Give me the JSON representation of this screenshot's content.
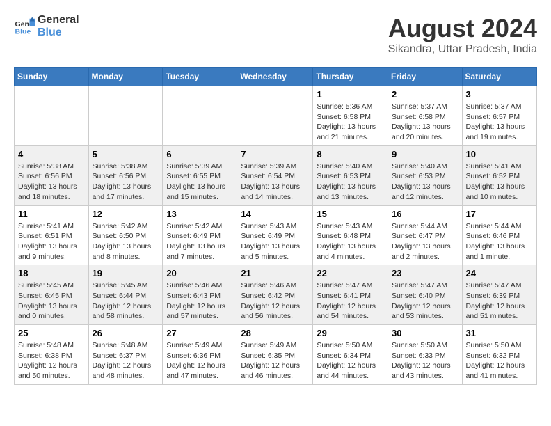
{
  "header": {
    "logo_line1": "General",
    "logo_line2": "Blue",
    "main_title": "August 2024",
    "subtitle": "Sikandra, Uttar Pradesh, India"
  },
  "days_of_week": [
    "Sunday",
    "Monday",
    "Tuesday",
    "Wednesday",
    "Thursday",
    "Friday",
    "Saturday"
  ],
  "weeks": [
    [
      {
        "day": "",
        "content": ""
      },
      {
        "day": "",
        "content": ""
      },
      {
        "day": "",
        "content": ""
      },
      {
        "day": "",
        "content": ""
      },
      {
        "day": "1",
        "content": "Sunrise: 5:36 AM\nSunset: 6:58 PM\nDaylight: 13 hours and 21 minutes."
      },
      {
        "day": "2",
        "content": "Sunrise: 5:37 AM\nSunset: 6:58 PM\nDaylight: 13 hours and 20 minutes."
      },
      {
        "day": "3",
        "content": "Sunrise: 5:37 AM\nSunset: 6:57 PM\nDaylight: 13 hours and 19 minutes."
      }
    ],
    [
      {
        "day": "4",
        "content": "Sunrise: 5:38 AM\nSunset: 6:56 PM\nDaylight: 13 hours and 18 minutes."
      },
      {
        "day": "5",
        "content": "Sunrise: 5:38 AM\nSunset: 6:56 PM\nDaylight: 13 hours and 17 minutes."
      },
      {
        "day": "6",
        "content": "Sunrise: 5:39 AM\nSunset: 6:55 PM\nDaylight: 13 hours and 15 minutes."
      },
      {
        "day": "7",
        "content": "Sunrise: 5:39 AM\nSunset: 6:54 PM\nDaylight: 13 hours and 14 minutes."
      },
      {
        "day": "8",
        "content": "Sunrise: 5:40 AM\nSunset: 6:53 PM\nDaylight: 13 hours and 13 minutes."
      },
      {
        "day": "9",
        "content": "Sunrise: 5:40 AM\nSunset: 6:53 PM\nDaylight: 13 hours and 12 minutes."
      },
      {
        "day": "10",
        "content": "Sunrise: 5:41 AM\nSunset: 6:52 PM\nDaylight: 13 hours and 10 minutes."
      }
    ],
    [
      {
        "day": "11",
        "content": "Sunrise: 5:41 AM\nSunset: 6:51 PM\nDaylight: 13 hours and 9 minutes."
      },
      {
        "day": "12",
        "content": "Sunrise: 5:42 AM\nSunset: 6:50 PM\nDaylight: 13 hours and 8 minutes."
      },
      {
        "day": "13",
        "content": "Sunrise: 5:42 AM\nSunset: 6:49 PM\nDaylight: 13 hours and 7 minutes."
      },
      {
        "day": "14",
        "content": "Sunrise: 5:43 AM\nSunset: 6:49 PM\nDaylight: 13 hours and 5 minutes."
      },
      {
        "day": "15",
        "content": "Sunrise: 5:43 AM\nSunset: 6:48 PM\nDaylight: 13 hours and 4 minutes."
      },
      {
        "day": "16",
        "content": "Sunrise: 5:44 AM\nSunset: 6:47 PM\nDaylight: 13 hours and 2 minutes."
      },
      {
        "day": "17",
        "content": "Sunrise: 5:44 AM\nSunset: 6:46 PM\nDaylight: 13 hours and 1 minute."
      }
    ],
    [
      {
        "day": "18",
        "content": "Sunrise: 5:45 AM\nSunset: 6:45 PM\nDaylight: 13 hours and 0 minutes."
      },
      {
        "day": "19",
        "content": "Sunrise: 5:45 AM\nSunset: 6:44 PM\nDaylight: 12 hours and 58 minutes."
      },
      {
        "day": "20",
        "content": "Sunrise: 5:46 AM\nSunset: 6:43 PM\nDaylight: 12 hours and 57 minutes."
      },
      {
        "day": "21",
        "content": "Sunrise: 5:46 AM\nSunset: 6:42 PM\nDaylight: 12 hours and 56 minutes."
      },
      {
        "day": "22",
        "content": "Sunrise: 5:47 AM\nSunset: 6:41 PM\nDaylight: 12 hours and 54 minutes."
      },
      {
        "day": "23",
        "content": "Sunrise: 5:47 AM\nSunset: 6:40 PM\nDaylight: 12 hours and 53 minutes."
      },
      {
        "day": "24",
        "content": "Sunrise: 5:47 AM\nSunset: 6:39 PM\nDaylight: 12 hours and 51 minutes."
      }
    ],
    [
      {
        "day": "25",
        "content": "Sunrise: 5:48 AM\nSunset: 6:38 PM\nDaylight: 12 hours and 50 minutes."
      },
      {
        "day": "26",
        "content": "Sunrise: 5:48 AM\nSunset: 6:37 PM\nDaylight: 12 hours and 48 minutes."
      },
      {
        "day": "27",
        "content": "Sunrise: 5:49 AM\nSunset: 6:36 PM\nDaylight: 12 hours and 47 minutes."
      },
      {
        "day": "28",
        "content": "Sunrise: 5:49 AM\nSunset: 6:35 PM\nDaylight: 12 hours and 46 minutes."
      },
      {
        "day": "29",
        "content": "Sunrise: 5:50 AM\nSunset: 6:34 PM\nDaylight: 12 hours and 44 minutes."
      },
      {
        "day": "30",
        "content": "Sunrise: 5:50 AM\nSunset: 6:33 PM\nDaylight: 12 hours and 43 minutes."
      },
      {
        "day": "31",
        "content": "Sunrise: 5:50 AM\nSunset: 6:32 PM\nDaylight: 12 hours and 41 minutes."
      }
    ]
  ]
}
